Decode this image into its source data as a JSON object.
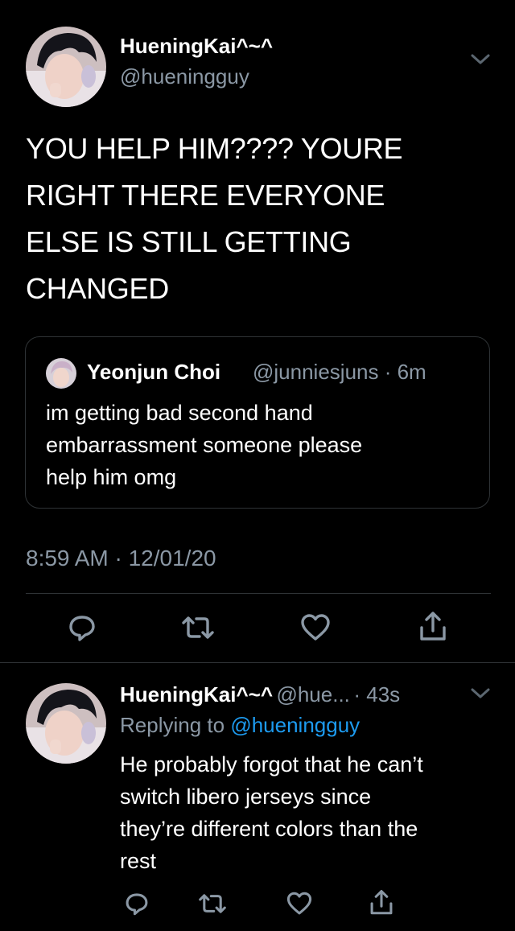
{
  "main_tweet": {
    "author_name": "HueningKai^~^",
    "author_handle": "@hueningguy",
    "text_lines": [
      "YOU HELP HIM???? YOURE",
      "RIGHT THERE EVERYONE",
      "ELSE IS STILL GETTING",
      "CHANGED"
    ],
    "timestamp": "8:59 AM · 12/01/20"
  },
  "quoted_tweet": {
    "author_name": "Yeonjun Choi",
    "author_handle": "@junniesjuns",
    "time": "· 6m",
    "text_lines": [
      "im getting bad second hand",
      "embarrassment someone please",
      "help him omg"
    ]
  },
  "actions": {
    "icons": [
      "reply-icon",
      "retweet-icon",
      "like-icon",
      "share-icon"
    ]
  },
  "reply_tweet": {
    "author_name": "HueningKai^~^",
    "author_handle": "@hue...",
    "time": "· 43s",
    "replying_prefix": "Replying to",
    "replying_handle": "@hueningguy",
    "text_lines": [
      "He probably forgot that he can’t",
      "switch libero jerseys since",
      "they’re different colors than the",
      "rest"
    ]
  },
  "colors": {
    "background": "#000000",
    "text": "#ffffff",
    "muted": "#8b98a5",
    "link": "#1d9bf0",
    "border": "#2f3336"
  }
}
